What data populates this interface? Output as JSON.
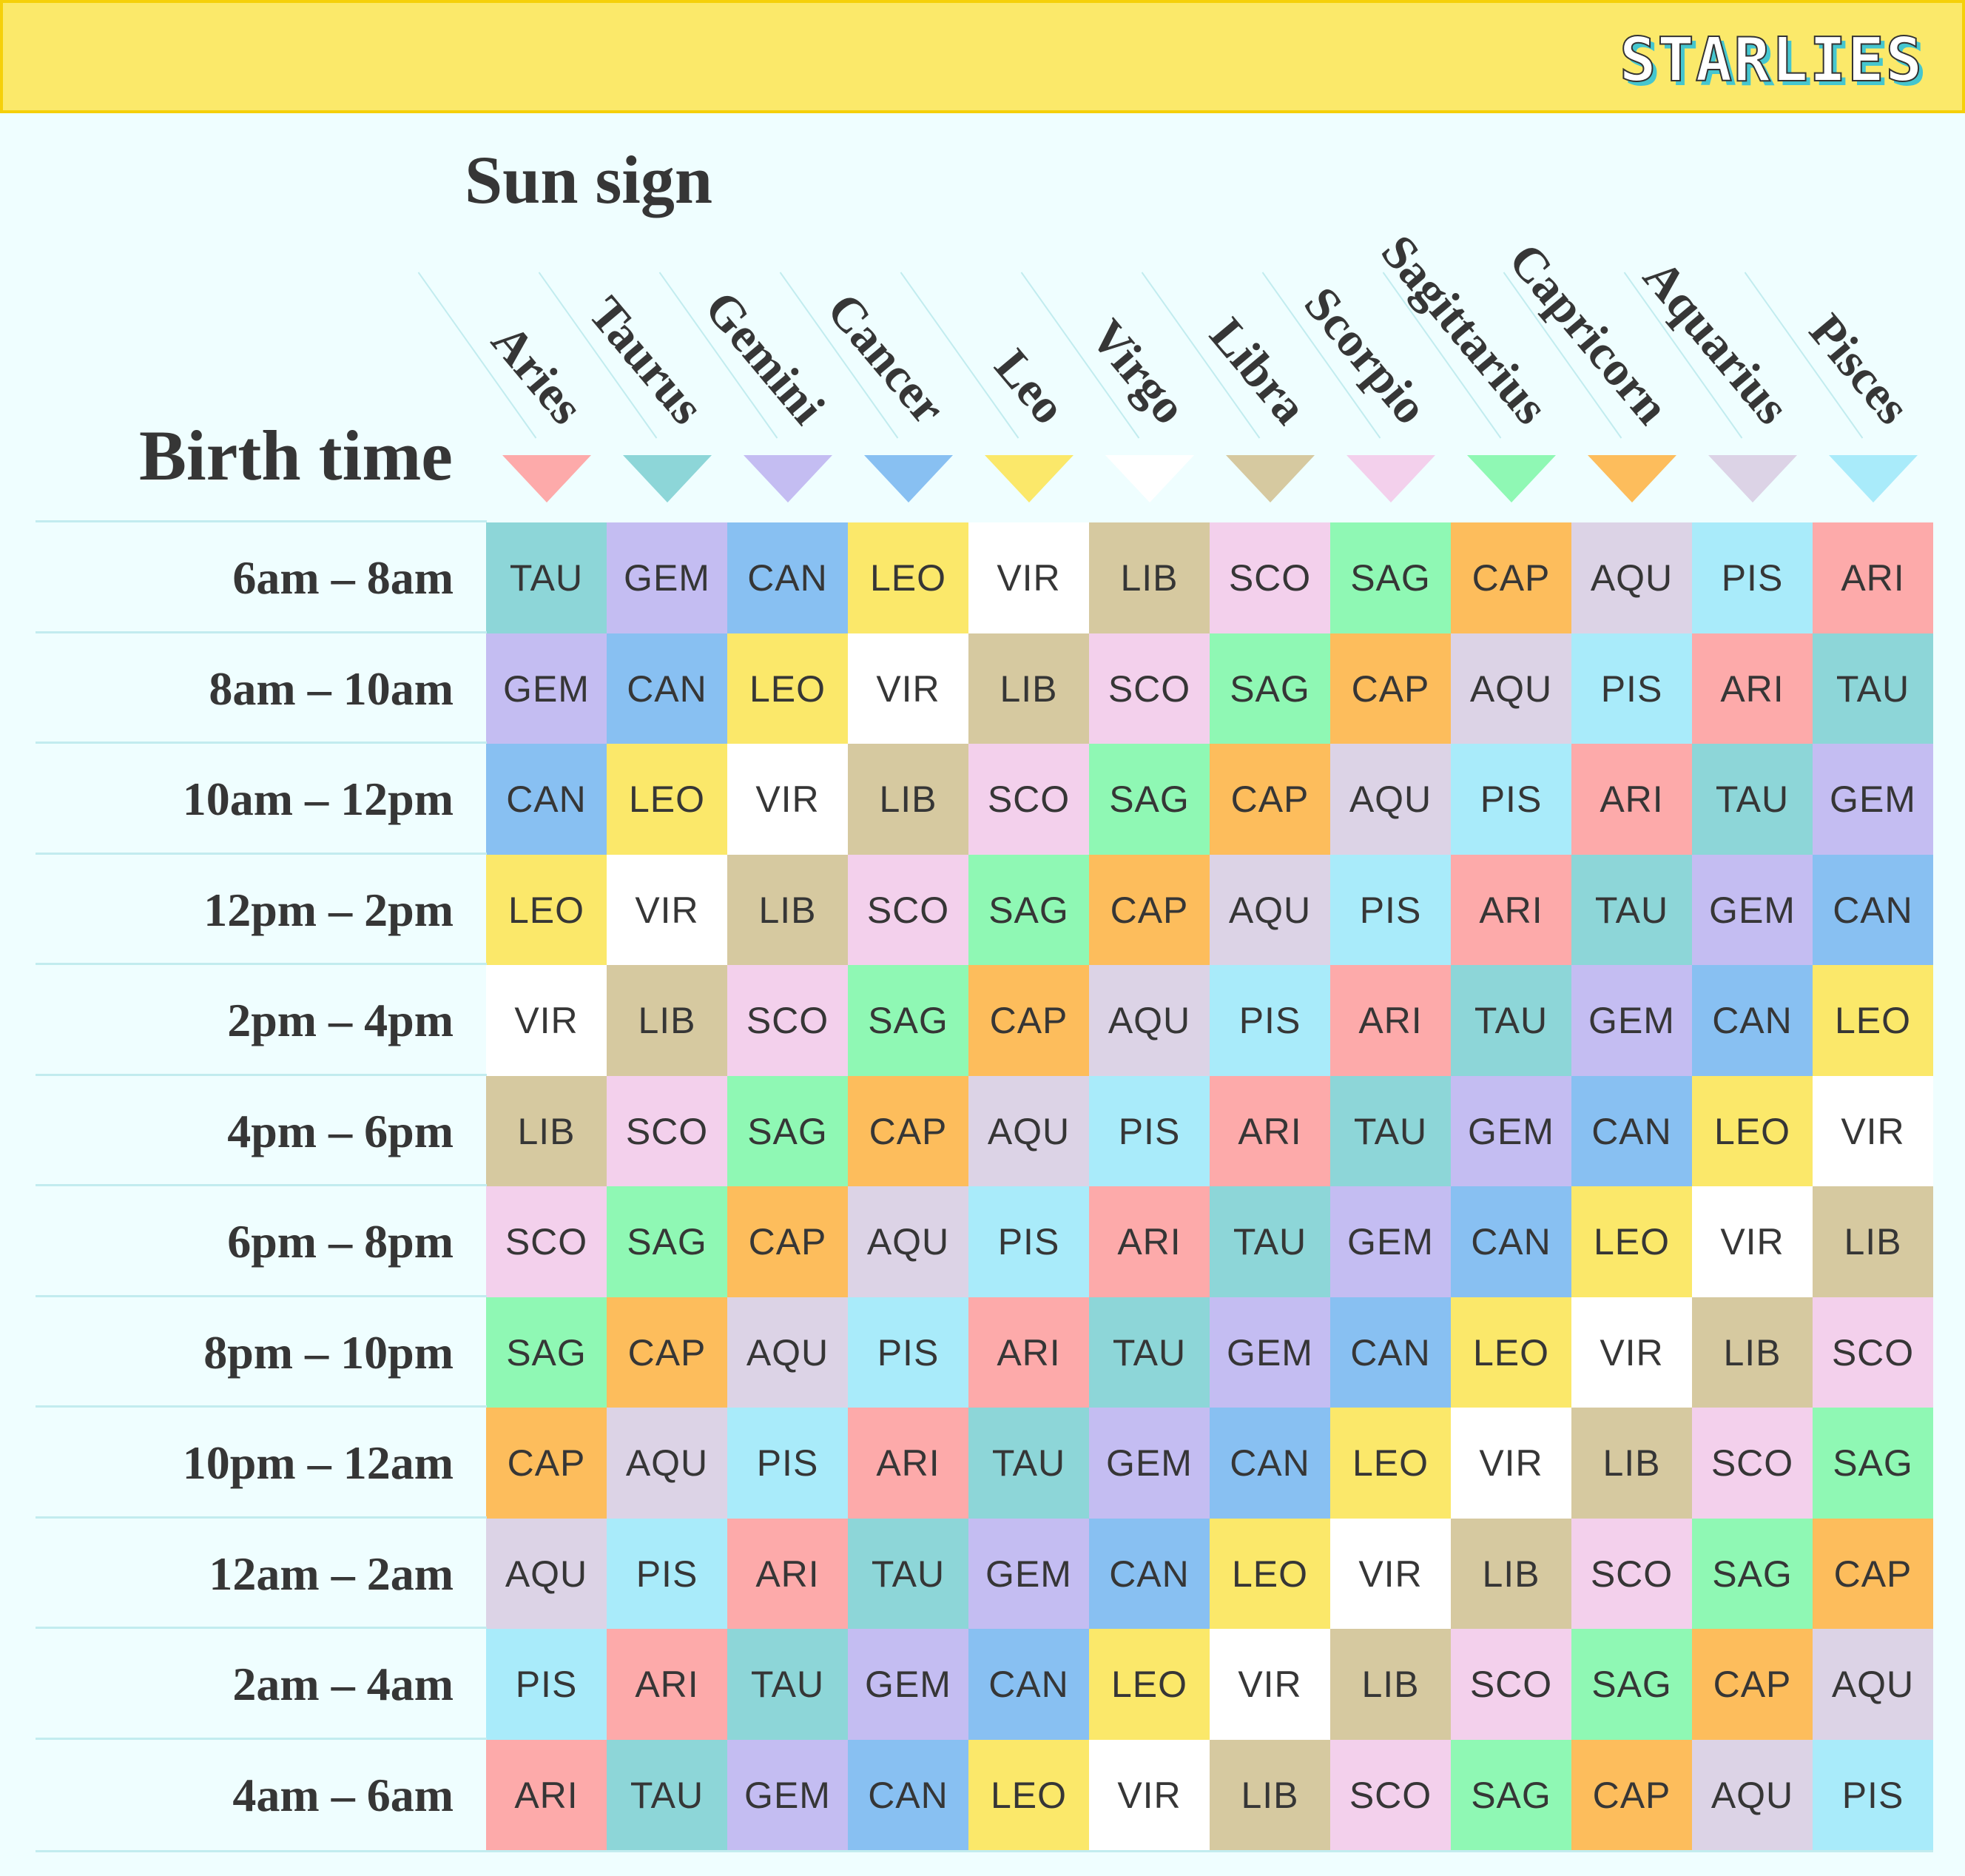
{
  "brand": {
    "logo_text": "STARLIES"
  },
  "chart_data": {
    "type": "table",
    "title": "Sun sign",
    "row_header": "Birth time",
    "columns": [
      "Aries",
      "Taurus",
      "Gemini",
      "Cancer",
      "Leo",
      "Virgo",
      "Libra",
      "Scorpio",
      "Sagittarius",
      "Capricorn",
      "Aquarius",
      "Pisces"
    ],
    "sign_colors": {
      "ARI": "#fdaaaa",
      "TAU": "#8dd6d8",
      "GEM": "#c4bdf2",
      "CAN": "#88c0f2",
      "LEO": "#fbe86a",
      "VIR": "#ffffff",
      "LIB": "#d6c9a0",
      "SCO": "#f3d0ec",
      "SAG": "#8ff8b4",
      "CAP": "#fdbd5c",
      "AQU": "#dcd3e6",
      "PIS": "#a9ebfa"
    },
    "column_colors": [
      "#fdaaaa",
      "#8dd6d8",
      "#c4bdf2",
      "#88c0f2",
      "#fbe86a",
      "#ffffff",
      "#d6c9a0",
      "#f3d0ec",
      "#8ff8b4",
      "#fdbd5c",
      "#dcd3e6",
      "#a9ebfa"
    ],
    "rows": [
      {
        "time": "6am – 8am",
        "cells": [
          "TAU",
          "GEM",
          "CAN",
          "LEO",
          "VIR",
          "LIB",
          "SCO",
          "SAG",
          "CAP",
          "AQU",
          "PIS",
          "ARI"
        ]
      },
      {
        "time": "8am – 10am",
        "cells": [
          "GEM",
          "CAN",
          "LEO",
          "VIR",
          "LIB",
          "SCO",
          "SAG",
          "CAP",
          "AQU",
          "PIS",
          "ARI",
          "TAU"
        ]
      },
      {
        "time": "10am – 12pm",
        "cells": [
          "CAN",
          "LEO",
          "VIR",
          "LIB",
          "SCO",
          "SAG",
          "CAP",
          "AQU",
          "PIS",
          "ARI",
          "TAU",
          "GEM"
        ]
      },
      {
        "time": "12pm – 2pm",
        "cells": [
          "LEO",
          "VIR",
          "LIB",
          "SCO",
          "SAG",
          "CAP",
          "AQU",
          "PIS",
          "ARI",
          "TAU",
          "GEM",
          "CAN"
        ]
      },
      {
        "time": "2pm – 4pm",
        "cells": [
          "VIR",
          "LIB",
          "SCO",
          "SAG",
          "CAP",
          "AQU",
          "PIS",
          "ARI",
          "TAU",
          "GEM",
          "CAN",
          "LEO"
        ]
      },
      {
        "time": "4pm – 6pm",
        "cells": [
          "LIB",
          "SCO",
          "SAG",
          "CAP",
          "AQU",
          "PIS",
          "ARI",
          "TAU",
          "GEM",
          "CAN",
          "LEO",
          "VIR"
        ]
      },
      {
        "time": "6pm – 8pm",
        "cells": [
          "SCO",
          "SAG",
          "CAP",
          "AQU",
          "PIS",
          "ARI",
          "TAU",
          "GEM",
          "CAN",
          "LEO",
          "VIR",
          "LIB"
        ]
      },
      {
        "time": "8pm – 10pm",
        "cells": [
          "SAG",
          "CAP",
          "AQU",
          "PIS",
          "ARI",
          "TAU",
          "GEM",
          "CAN",
          "LEO",
          "VIR",
          "LIB",
          "SCO"
        ]
      },
      {
        "time": "10pm – 12am",
        "cells": [
          "CAP",
          "AQU",
          "PIS",
          "ARI",
          "TAU",
          "GEM",
          "CAN",
          "LEO",
          "VIR",
          "LIB",
          "SCO",
          "SAG"
        ]
      },
      {
        "time": "12am – 2am",
        "cells": [
          "AQU",
          "PIS",
          "ARI",
          "TAU",
          "GEM",
          "CAN",
          "LEO",
          "VIR",
          "LIB",
          "SCO",
          "SAG",
          "CAP"
        ]
      },
      {
        "time": "2am – 4am",
        "cells": [
          "PIS",
          "ARI",
          "TAU",
          "GEM",
          "CAN",
          "LEO",
          "VIR",
          "LIB",
          "SCO",
          "SAG",
          "CAP",
          "AQU"
        ]
      },
      {
        "time": "4am – 6am",
        "cells": [
          "ARI",
          "TAU",
          "GEM",
          "CAN",
          "LEO",
          "VIR",
          "LIB",
          "SCO",
          "SAG",
          "CAP",
          "AQU",
          "PIS"
        ]
      }
    ]
  }
}
